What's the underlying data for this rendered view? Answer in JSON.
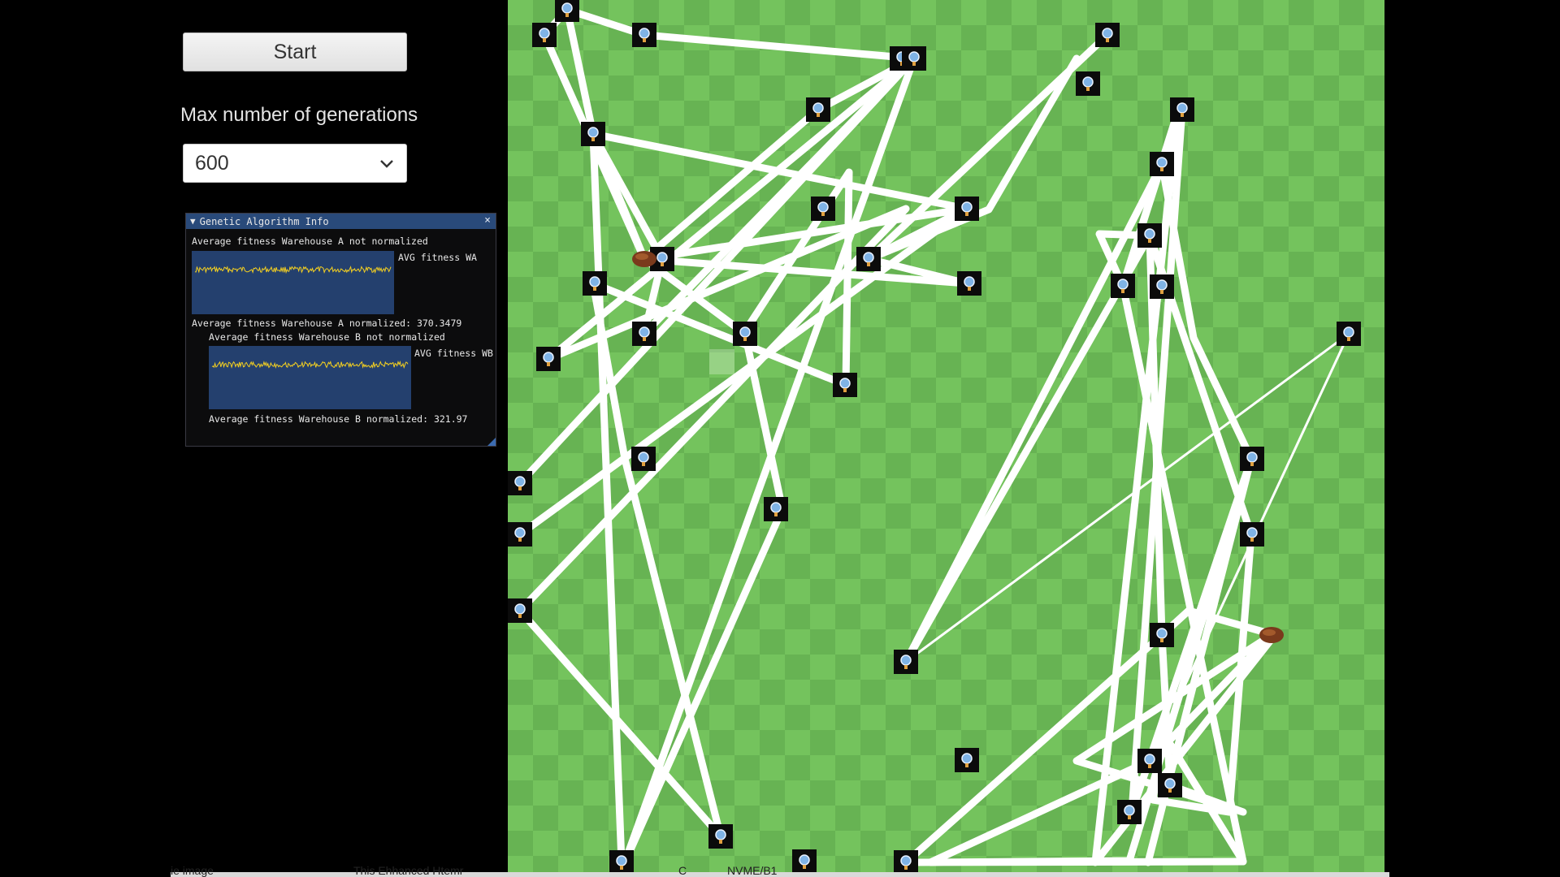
{
  "controls": {
    "start_label": "Start",
    "generations_label": "Max number of generations",
    "generations_value": "600"
  },
  "ga_window": {
    "title": "Genetic Algorithm Info",
    "wa_header": "Average fitness Warehouse A not normalized",
    "wa_plot_label": "AVG fitness WA",
    "wa_normalized": "Average fitness Warehouse A normalized: 370.3479",
    "wb_header": "Average fitness Warehouse B not normalized",
    "wb_plot_label": "AVG fitness WB",
    "wb_normalized": "Average fitness Warehouse B normalized: 321.97",
    "plot_color": "#f5d020"
  },
  "board": {
    "colors": {
      "grass_light": "#74c35d",
      "grass_dark": "#67b353",
      "route": "#ffffff",
      "warehouse": "#7a3a1c"
    },
    "icon": "delivery-point-icon"
  },
  "footer": {
    "fragments": [
      "ie image",
      "This Ehhanced Htemr",
      "C",
      "NVME/B1"
    ]
  }
}
